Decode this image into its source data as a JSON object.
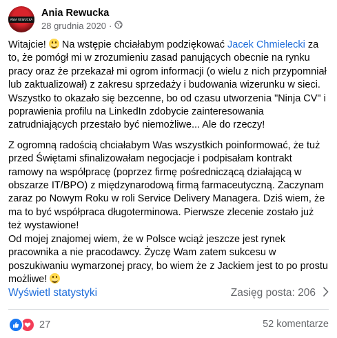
{
  "post": {
    "author": "Ania Rewucka",
    "date": "28 grudnia 2020",
    "separator": "·",
    "avatar_text": "ANIA REWUCKA",
    "body": {
      "p1_intro": "Witajcie! ",
      "p1_mid": " Na wstępie chciałabym podziękować ",
      "p1_mention": "Jacek Chmielecki",
      "p1_rest": " za to, że pomógł mi w zrozumieniu zasad panujących obecnie na rynku pracy oraz że przekazał mi ogrom informacji (o wielu z nich przypomniał lub zaktualizował) z zakresu sprzedaży i budowania wizerunku w sieci. Wszystko to okazało się bezcenne, bo od czasu utworzenia \"Ninja CV\" i poprawienia profilu na LinkedIn zdobycie zainteresowania zatrudniających przestało być niemożliwe... Ale do rzeczy!",
      "p2": "Z ogromną radością chciałabym Was wszystkich poinformować, że tuż przed Świętami sfinalizowałam negocjacje i podpisałam kontrakt ramowy na współpracę (poprzez firmę pośredniczącą działającą w obszarze IT/BPO) z międzynarodową  firmą farmaceutyczną. Zaczynam zaraz po Nowym Roku w roli Service Delivery Managera. Dziś wiem, że ma to być współpraca długoterminowa. Pierwsze zlecenie zostało już też wystawione!",
      "p3": "Od mojej znajomej wiem, że w Polsce wciąż jeszcze jest rynek pracownika a nie pracodawcy. Życzę Wam zatem sukcesu w poszukiwaniu wymarzonej pracy, bo wiem że z Jackiem jest to po prostu możliwe! "
    },
    "stats_link": "Wyświetl statystyki",
    "reach_label": "Zasięg posta: 206",
    "reactions_count": "27",
    "comments_label": "52 komentarze",
    "colors": {
      "link": "#216fdb",
      "secondary": "#65676b",
      "like": "#1877f2",
      "love": "#f33e58"
    },
    "icons": [
      "globe-icon",
      "smile-emoji-icon",
      "chevron-right-icon",
      "like-reaction-icon",
      "love-reaction-icon"
    ]
  }
}
